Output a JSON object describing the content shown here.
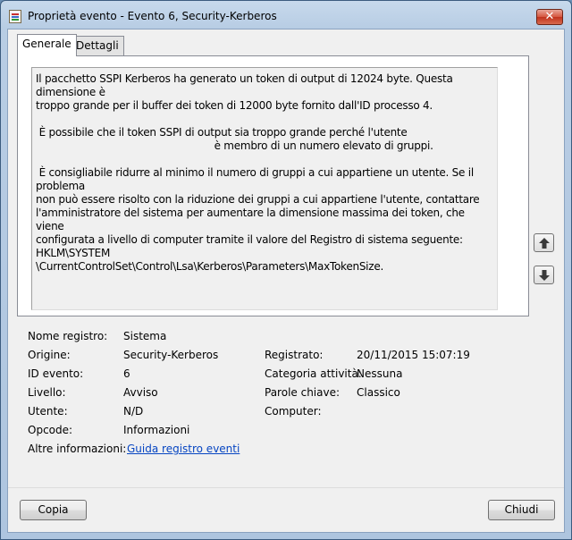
{
  "window": {
    "title": "Proprietà evento - Evento 6, Security-Kerberos",
    "close_glyph": "✕"
  },
  "tabs": [
    {
      "label": "Generale",
      "active": true
    },
    {
      "label": "Dettagli",
      "active": false
    }
  ],
  "message": {
    "text": "Il pacchetto SSPI Kerberos ha generato un token di output di 12024 byte. Questa dimensione è\ntroppo grande per il buffer dei token di 12000 byte fornito dall'ID processo 4.\n\n È possibile che il token SSPI di output sia troppo grande perché l'utente\n                                                        è membro di un numero elevato di gruppi.\n\n È consigliabile ridurre al minimo il numero di gruppi a cui appartiene un utente. Se il problema\nnon può essere risolto con la riduzione dei gruppi a cui appartiene l'utente, contattare\nl'amministratore del sistema per aumentare la dimensione massima dei token, che viene\nconfigurata a livello di computer tramite il valore del Registro di sistema seguente: HKLM\\SYSTEM\n\\CurrentControlSet\\Control\\Lsa\\Kerberos\\Parameters\\MaxTokenSize."
  },
  "details": {
    "log_name": {
      "label": "Nome registro:",
      "value": "Sistema"
    },
    "source": {
      "label": "Origine:",
      "value": "Security-Kerberos"
    },
    "logged": {
      "label": "Registrato:",
      "value": "20/11/2015 15:07:19"
    },
    "event_id": {
      "label": "ID evento:",
      "value": "6"
    },
    "task_category": {
      "label": "Categoria attività:",
      "value": "Nessuna"
    },
    "level": {
      "label": "Livello:",
      "value": "Avviso"
    },
    "keywords": {
      "label": "Parole chiave:",
      "value": "Classico"
    },
    "user": {
      "label": "Utente:",
      "value": "N/D"
    },
    "computer": {
      "label": "Computer:",
      "value": ""
    },
    "opcode": {
      "label": "Opcode:",
      "value": "Informazioni"
    },
    "more_info": {
      "label": "Altre informazioni:",
      "link": "Guida registro eventi"
    }
  },
  "buttons": {
    "copy": "Copia",
    "close": "Chiudi"
  },
  "icons": {
    "up": "arrow-up-icon",
    "down": "arrow-down-icon"
  }
}
